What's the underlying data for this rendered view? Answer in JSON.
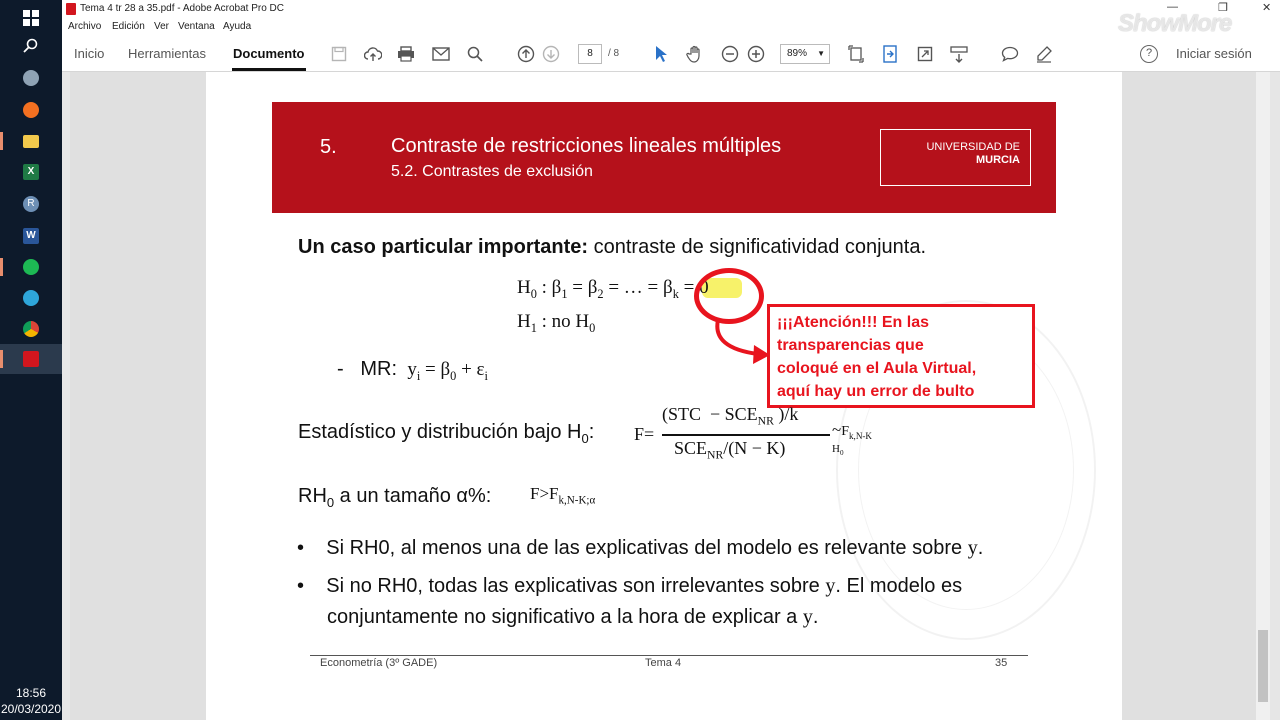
{
  "window": {
    "title": "Tema 4 tr 28 a 35.pdf - Adobe Acrobat Pro DC",
    "menu": [
      "Archivo",
      "Edición",
      "Ver",
      "Ventana",
      "Ayuda"
    ]
  },
  "toolbar": {
    "tabs": [
      "Inicio",
      "Herramientas",
      "Documento"
    ],
    "active_tab": "Documento",
    "page_current": "8",
    "page_total": "/ 8",
    "zoom": "89%",
    "signin": "Iniciar sesión",
    "help": "?"
  },
  "watermark": "ShowMore",
  "clock": {
    "time": "18:56",
    "date": "20/03/2020"
  },
  "slide": {
    "section_number": "5.",
    "title": "Contraste de restricciones lineales múltiples",
    "subtitle": "5.2. Contrastes de exclusión",
    "logo_line1": "UNIVERSIDAD DE",
    "logo_line2": "MURCIA",
    "lead_bold": "Un caso particular importante:",
    "lead_rest": " contraste de significatividad conjunta.",
    "mr_label": "MR:",
    "stat_label": "Estadístico y distribución bajo H",
    "stat_sub": "0",
    "rh_label": "RH",
    "rh_sub": "0",
    "rh_rest": " a un tamaño α%:",
    "bullet1": "Si RH0, al menos una de las explicativas del modelo es relevante sobre ",
    "bullet1_var": "y",
    "bullet2a": "Si no RH0, todas las explicativas son irrelevantes sobre ",
    "bullet2_var": "y",
    "bullet2b": ". El modelo es",
    "bullet2c": "conjuntamente no significativo a la hora de explicar a ",
    "bullet2c_var": "y"
  },
  "annotation": {
    "lines": [
      "¡¡¡Atención!!! En las",
      "transparencias que",
      "coloqué en el Aula Virtual,",
      "aquí hay un error de bulto"
    ],
    "color": "#e8141e"
  },
  "footer": {
    "left": "Econometría (3º GADE)",
    "center": "Tema 4",
    "right": "35"
  },
  "colors": {
    "header_red": "#b5111b",
    "annotation_red": "#e8141e",
    "highlight": "#f7f26a"
  }
}
